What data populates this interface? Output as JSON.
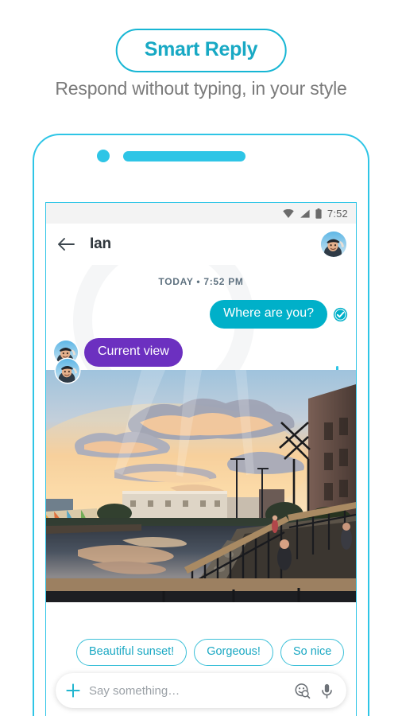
{
  "promo": {
    "badge_label": "Smart Reply",
    "subtitle": "Respond without typing, in your style",
    "accent_color": "#17b6d4",
    "subtitle_color": "#7b7b7b"
  },
  "phone": {
    "frame_color": "#2ec5e6",
    "camera_icon": "camera-dot",
    "speaker_icon": "speaker-grill",
    "side_buttons": [
      "volume-up-button",
      "volume-down-button"
    ]
  },
  "status_bar": {
    "wifi_icon": "wifi-icon",
    "signal_icon": "cell-signal-icon",
    "battery_icon": "battery-icon",
    "clock": "7:52"
  },
  "app_bar": {
    "back_icon": "back-arrow-icon",
    "title": "Ian",
    "avatar_icon": "contact-avatar"
  },
  "conversation": {
    "daystamp": "TODAY • 7:52 PM",
    "messages": [
      {
        "id": "msg-outgoing-1",
        "direction": "outgoing",
        "type": "text",
        "text": "Where are you?",
        "bubble_color": "#00b0c9",
        "status_icon": "read-receipt-check-icon"
      },
      {
        "id": "msg-incoming-1",
        "direction": "incoming",
        "type": "text",
        "text": "Current view",
        "bubble_color": "#6c30c0",
        "avatar_icon": "sender-avatar"
      },
      {
        "id": "msg-incoming-2",
        "direction": "incoming",
        "type": "photo",
        "photo_alt": "Sunset over a canal with buildings, clouds and a railed boardwalk",
        "avatar_icon": "sender-avatar"
      }
    ]
  },
  "smart_reply": {
    "chips": [
      {
        "label": "Beautiful sunset!"
      },
      {
        "label": "Gorgeous!"
      },
      {
        "label": "So nice"
      }
    ],
    "chip_color": "#1aa8c3",
    "chip_border_color": "#3bc0d8"
  },
  "composer": {
    "plus_icon": "plus-icon",
    "input_value": "",
    "placeholder": "Say something…",
    "sticker_icon": "sticker-search-icon",
    "mic_icon": "microphone-icon"
  }
}
